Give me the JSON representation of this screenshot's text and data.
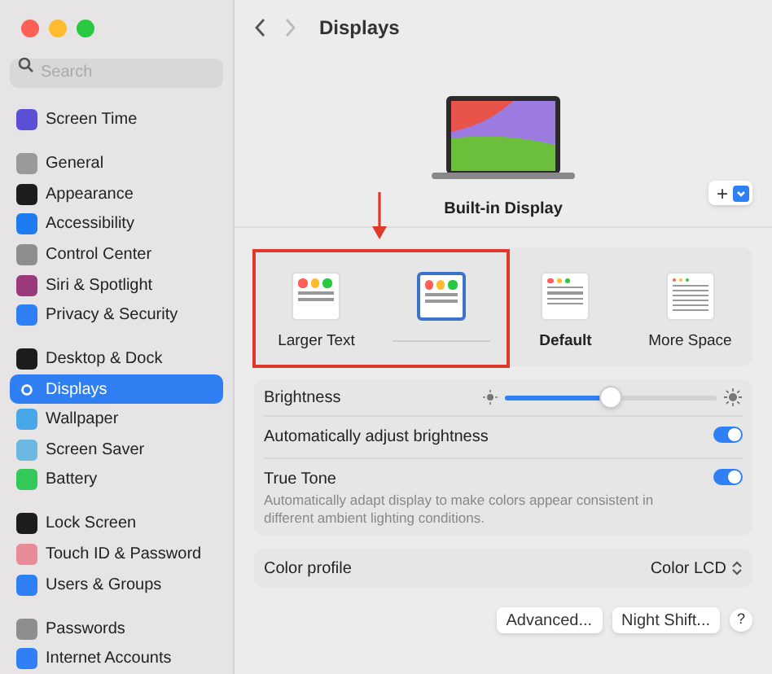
{
  "window": {
    "title": "Displays"
  },
  "sidebar": {
    "search": {
      "placeholder": "Search"
    },
    "groups": [
      [
        {
          "label": "Screen Time",
          "selected": false,
          "color": "#5b4fd6"
        }
      ],
      [
        {
          "label": "General",
          "selected": false,
          "color": "#9a9a9a"
        },
        {
          "label": "Appearance",
          "selected": false,
          "color": "#1c1c1c"
        },
        {
          "label": "Accessibility",
          "selected": false,
          "color": "#1f7cf0"
        },
        {
          "label": "Control Center",
          "selected": false,
          "color": "#8e8e8e"
        },
        {
          "label": "Siri & Spotlight",
          "selected": false,
          "color": "#9b3a7a"
        },
        {
          "label": "Privacy & Security",
          "selected": false,
          "color": "#2f80f5"
        }
      ],
      [
        {
          "label": "Desktop & Dock",
          "selected": false,
          "color": "#1c1c1c"
        },
        {
          "label": "Displays",
          "selected": true,
          "color": "#2f80f5"
        },
        {
          "label": "Wallpaper",
          "selected": false,
          "color": "#48a7e8"
        },
        {
          "label": "Screen Saver",
          "selected": false,
          "color": "#6cb8e0"
        },
        {
          "label": "Battery",
          "selected": false,
          "color": "#34c759"
        }
      ],
      [
        {
          "label": "Lock Screen",
          "selected": false,
          "color": "#1c1c1c"
        },
        {
          "label": "Touch ID & Password",
          "selected": false,
          "color": "#e98a97"
        },
        {
          "label": "Users & Groups",
          "selected": false,
          "color": "#2f80f5"
        }
      ],
      [
        {
          "label": "Passwords",
          "selected": false,
          "color": "#8e8e8e"
        },
        {
          "label": "Internet Accounts",
          "selected": false,
          "color": "#2f80f5"
        }
      ]
    ]
  },
  "display": {
    "name": "Built-in Display",
    "add_button": "+"
  },
  "resolutions": [
    {
      "label": "Larger Text",
      "selected": false,
      "kind": "large"
    },
    {
      "selected": true,
      "kind": "large"
    },
    {
      "label": "Default",
      "selected": false,
      "kind": "medium"
    },
    {
      "label": "More Space",
      "selected": false,
      "kind": "small"
    }
  ],
  "brightness": {
    "label": "Brightness",
    "level": 0.5
  },
  "settings": [
    {
      "label": "Automatically adjust brightness",
      "on": true
    },
    {
      "label": "True Tone",
      "description": "Automatically adapt display to make colors appear consistent in different ambient lighting conditions.",
      "on": true
    }
  ],
  "color_profile": {
    "label": "Color profile",
    "value": "Color LCD"
  },
  "buttons": [
    "Advanced...",
    "Night Shift..."
  ],
  "help_button": "?"
}
